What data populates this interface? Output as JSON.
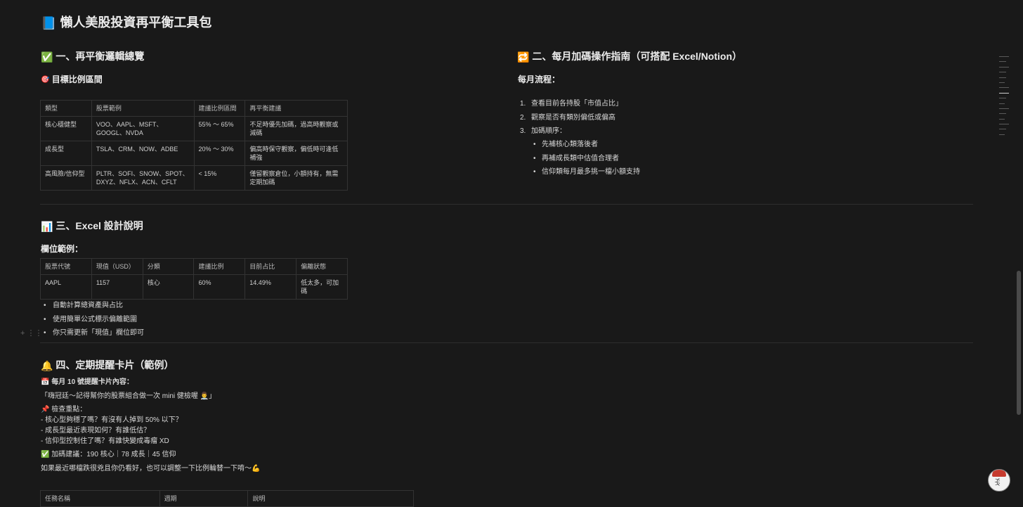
{
  "page": {
    "icon": "📘",
    "title": "懶人美股投資再平衡工具包"
  },
  "section1": {
    "icon": "✅",
    "title": "一、再平衡邏輯總覽",
    "sub_icon": "🎯",
    "sub_title": "目標比例區間",
    "table": {
      "headers": [
        "類型",
        "股票範例",
        "建議比例區間",
        "再平衡建議"
      ],
      "rows": [
        [
          "核心穩健型",
          "VOO、AAPL、MSFT、GOOGL、NVDA",
          "55% ～ 65%",
          "不足時優先加碼，過高時觀察或減碼"
        ],
        [
          "成長型",
          "TSLA、CRM、NOW、ADBE",
          "20% ～ 30%",
          "偏高時保守觀察，偏低時可逢低補強"
        ],
        [
          "高風險/信仰型",
          "PLTR、SOFI、SNOW、SPOT、DXYZ、NFLX、ACN、CFLT",
          "< 15%",
          "僅留觀察倉位，小額持有，無需定期加碼"
        ]
      ]
    }
  },
  "section2": {
    "icon": "🔁",
    "title": "二、每月加碼操作指南（可搭配 Excel/Notion）",
    "sub_title": "每月流程：",
    "steps": [
      "查看目前各持股「市值占比」",
      "觀察是否有類別偏低或偏高",
      "加碼順序："
    ],
    "substeps": [
      "先補核心類落後者",
      "再補成長類中估值合理者",
      "信仰類每月最多挑一檔小額支持"
    ]
  },
  "section3": {
    "icon": "📊",
    "title": "三、Excel 設計說明",
    "sub_title": "欄位範例：",
    "table": {
      "headers": [
        "股票代號",
        "現值（USD）",
        "分類",
        "建議比例",
        "目前占比",
        "偏離狀態"
      ],
      "rows": [
        [
          "AAPL",
          "1157",
          "核心",
          "60%",
          "14.49%",
          "低太多，可加碼"
        ]
      ]
    },
    "bullets": [
      "自動計算總資產與占比",
      "使用簡單公式標示偏離範圍",
      "你只需更新「現值」欄位即可"
    ]
  },
  "section4": {
    "icon": "🔔",
    "title": "四、定期提醒卡片（範例）",
    "card_icon": "📅",
    "card_title": "每月 10 號提醒卡片內容：",
    "greeting": "「嗨冠廷～記得幫你的股票組合做一次 mini 健檢喔 👨‍⚕️」",
    "check_icon": "📌",
    "check_title": "檢查重點：",
    "check_items": [
      "- 核心型夠穩了嗎？有沒有人掉到 50% 以下？",
      "- 成長型最近表現如何？有誰低估？",
      "- 信仰型控制住了嗎？有誰快變成毒瘤 XD"
    ],
    "advice_icon": "✅",
    "advice": "加碼建議：190 核心｜78 成長｜45 信仰",
    "closing": "如果最近哪檔跌很兇且你仍看好，也可以調整一下比例輪替一下唷～💪"
  },
  "section5": {
    "table_headers": [
      "任務名稱",
      "週期",
      "說明"
    ]
  },
  "colors": {
    "background": "#191919",
    "text": "#d4d4d4",
    "border": "#333333"
  }
}
